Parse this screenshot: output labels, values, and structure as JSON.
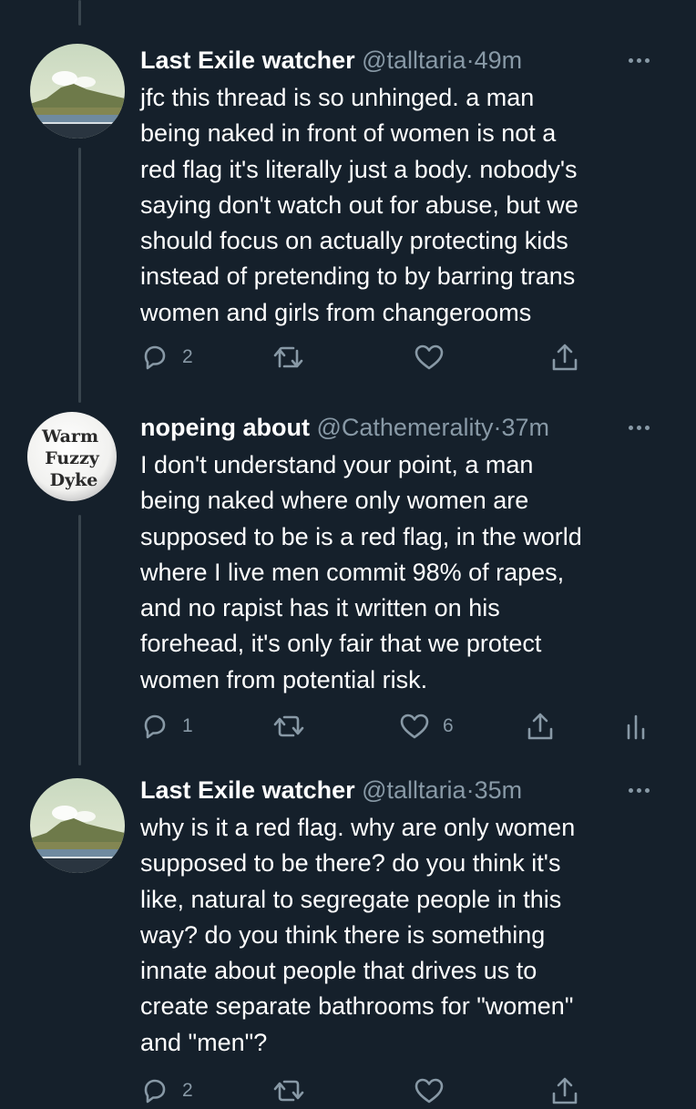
{
  "tweets": [
    {
      "name": "Last Exile watcher",
      "handle": "@talltaria",
      "separator": "·",
      "time": "49m",
      "avatar_icon": "landscape-avatar-icon",
      "lines": [
        "jfc this thread is so unhinged. a man",
        "being naked in front of women is not a",
        "red flag it's literally just a body. nobody's",
        "saying don't watch out for abuse, but we",
        "should focus on actually protecting kids",
        "instead of pretending to by barring trans",
        "women and girls from changerooms"
      ],
      "replies": "2",
      "retweets": "",
      "likes": "",
      "show_analytics": false
    },
    {
      "name": "nopeing about",
      "handle": "@Cathemerality",
      "separator": "·",
      "time": "37m",
      "avatar_icon": "button-badge-avatar-icon",
      "avatar_text": [
        "Warm",
        "Fuzzy",
        "Dyke"
      ],
      "lines": [
        "I don't understand your point, a man",
        "being naked where only women are",
        "supposed to be is a red flag, in the world",
        "where I live men commit 98% of rapes,",
        "and no rapist has it written on his",
        "forehead, it's only fair that we protect",
        "women from potential risk."
      ],
      "replies": "1",
      "retweets": "",
      "likes": "6",
      "show_analytics": true
    },
    {
      "name": "Last Exile watcher",
      "handle": "@talltaria",
      "separator": "·",
      "time": "35m",
      "avatar_icon": "landscape-avatar-icon",
      "lines": [
        "why is it a red flag. why are only women",
        "supposed to be there? do you think it's",
        "like, natural to segregate people in this",
        "way? do you think there is something",
        "innate about people that drives us to",
        "create separate bathrooms for \"women\"",
        "and \"men\"?"
      ],
      "replies": "2",
      "retweets": "",
      "likes": "",
      "show_analytics": false
    }
  ],
  "icons": {
    "reply": "reply-icon",
    "retweet": "retweet-icon",
    "like": "heart-icon",
    "share": "share-icon",
    "analytics": "analytics-icon",
    "more": "more-icon"
  },
  "colors": {
    "background": "#15202b",
    "text": "#ffffff",
    "secondary": "#8899a6",
    "thread_line": "#38444d"
  }
}
